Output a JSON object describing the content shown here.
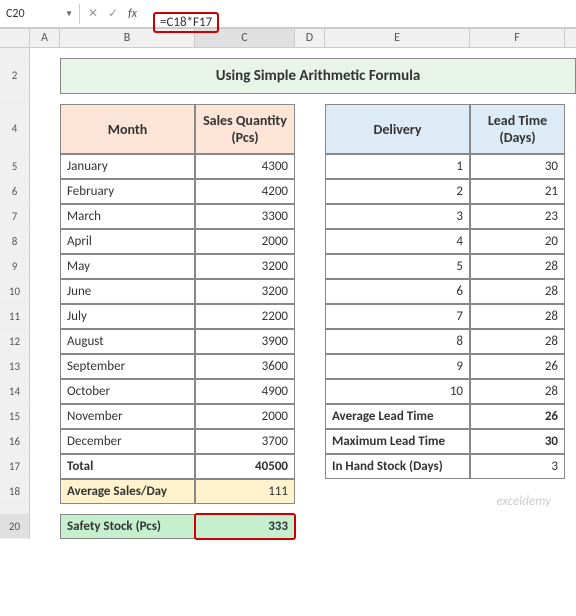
{
  "nameBox": "C20",
  "formula": "=C18*F17",
  "title": "Using Simple Arithmetic Formula",
  "colHeaders": [
    "A",
    "B",
    "C",
    "D",
    "E",
    "F"
  ],
  "headers": {
    "month": "Month",
    "salesQty": "Sales Quantity (Pcs)",
    "delivery": "Delivery",
    "leadTime": "Lead Time (Days)"
  },
  "months": [
    {
      "name": "January",
      "qty": 4300,
      "del": 1,
      "lt": 30
    },
    {
      "name": "February",
      "qty": 4200,
      "del": 2,
      "lt": 21
    },
    {
      "name": "March",
      "qty": 3300,
      "del": 3,
      "lt": 23
    },
    {
      "name": "April",
      "qty": 2000,
      "del": 4,
      "lt": 20
    },
    {
      "name": "May",
      "qty": 3200,
      "del": 5,
      "lt": 28
    },
    {
      "name": "June",
      "qty": 3200,
      "del": 6,
      "lt": 28
    },
    {
      "name": "July",
      "qty": 2200,
      "del": 7,
      "lt": 28
    },
    {
      "name": "August",
      "qty": 3900,
      "del": 8,
      "lt": 28
    },
    {
      "name": "September",
      "qty": 3600,
      "del": 9,
      "lt": 26
    },
    {
      "name": "October",
      "qty": 4900,
      "del": 10,
      "lt": 28
    }
  ],
  "novDec": [
    {
      "name": "November",
      "qty": 2000
    },
    {
      "name": "December",
      "qty": 3700
    }
  ],
  "summaryRight": [
    {
      "label": "Average Lead Time",
      "val": 26
    },
    {
      "label": "Maximum Lead Time",
      "val": 30
    },
    {
      "label": "In Hand Stock (Days)",
      "val": 3
    }
  ],
  "totalLabel": "Total",
  "totalVal": 40500,
  "avgLabel": "Average Sales/Day",
  "avgVal": 111,
  "safetyLabel": "Safety Stock (Pcs)",
  "safetyVal": 333,
  "watermark": "exceldemy"
}
